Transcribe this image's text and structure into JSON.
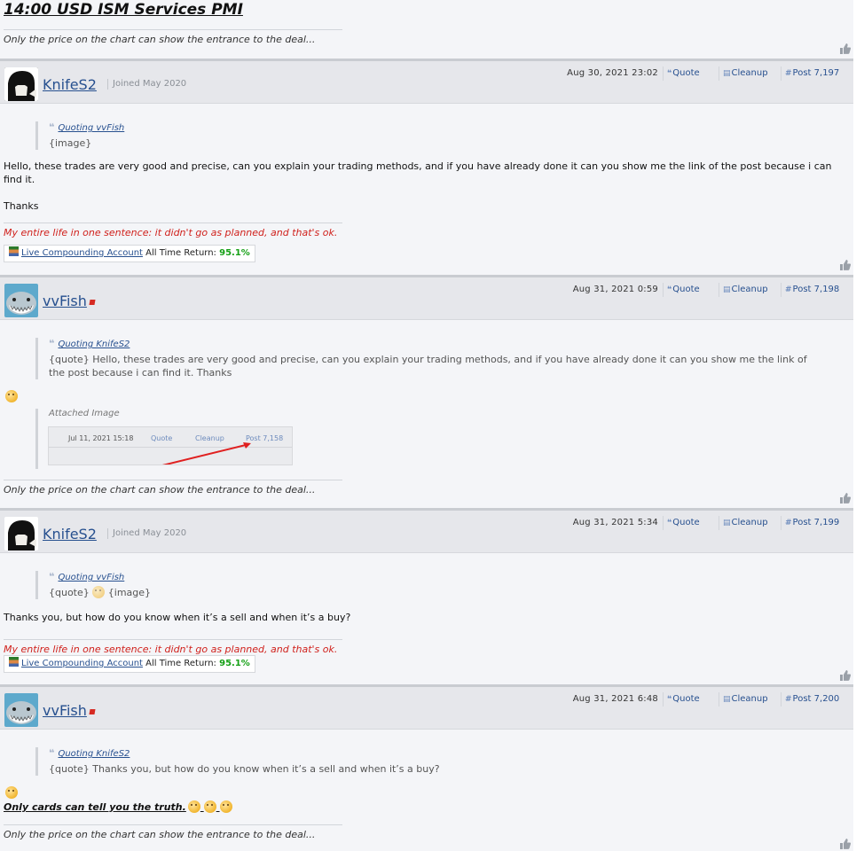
{
  "top": {
    "title": "14:00 USD ISM Services PMI",
    "signature": "Only the price on the chart can show the entrance to the deal..."
  },
  "toolbar": {
    "quote": "Quote",
    "cleanup": "Cleanup"
  },
  "posts": [
    {
      "author": "KnifeS2",
      "joined": "Joined May 2020",
      "date": "Aug 30, 2021 23:02",
      "post_no": "Post 7,197",
      "quote_head": "Quoting vvFish",
      "quote_body": "{image}",
      "body1": "Hello, these trades are very good and precise, can you explain your trading methods, and if you have already done it can you show me the link of the post because i can find it.",
      "body2": "Thanks",
      "signature": "My entire life in one sentence: it didn't go as planned, and that's ok.",
      "account_link": "Live Compounding Account",
      "account_label": "All Time Return:",
      "account_pct": "95.1%"
    },
    {
      "author": "vvFish",
      "date": "Aug 31, 2021 0:59",
      "post_no": "Post 7,198",
      "quote_head": "Quoting KnifeS2",
      "quote_body": "{quote} Hello, these trades are very good and precise, can you explain your trading methods, and if you have already done it can you show me the link of the post because i can find it. Thanks",
      "attached_label": "Attached Image",
      "image": {
        "date": "Jul 11, 2021 15:18",
        "quote": "Quote",
        "cleanup": "Cleanup",
        "post": "Post 7,158"
      },
      "signature": "Only the price on the chart can show the entrance to the deal..."
    },
    {
      "author": "KnifeS2",
      "joined": "Joined May 2020",
      "date": "Aug 31, 2021 5:34",
      "post_no": "Post 7,199",
      "quote_head": "Quoting vvFish",
      "quote_body_a": "{quote}",
      "quote_body_b": "{image}",
      "body": "Thanks you, but how do you know when it’s a sell and when it’s a buy?",
      "signature": "My entire life in one sentence: it didn't go as planned, and that's ok.",
      "account_link": "Live Compounding Account",
      "account_label": "All Time Return:",
      "account_pct": "95.1%"
    },
    {
      "author": "vvFish",
      "date": "Aug 31, 2021 6:48",
      "post_no": "Post 7,200",
      "quote_head": "Quoting KnifeS2",
      "quote_body": "{quote} Thanks you, but how do you know when it’s a sell and when it’s a buy?",
      "bold": "Only cards can tell you the truth.",
      "signature": "Only the price on the chart can show the entrance to the deal..."
    }
  ],
  "icons": {
    "thumb": "thumbs-up-icon",
    "quote": "quote-icon",
    "cleanup": "cleanup-icon",
    "hash": "hash-icon",
    "online": "online-status-icon",
    "emoji": "thinking-emoji-icon"
  }
}
